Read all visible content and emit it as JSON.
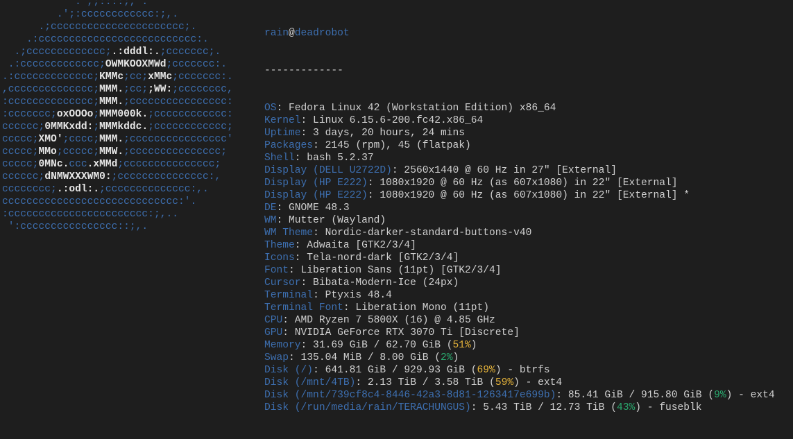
{
  "logo": [
    [
      [
        "b",
        "            .',;::::;,'."
      ]
    ],
    [
      [
        "b",
        "         .';:cccccccccccc:;,."
      ]
    ],
    [
      [
        "b",
        "      .;cccccccccccccccccccccc;."
      ]
    ],
    [
      [
        "b",
        "    .:cccccccccccccccccccccccccc:."
      ]
    ],
    [
      [
        "b",
        "  .;ccccccccccccc;"
      ],
      [
        "w",
        ".:dddl:."
      ],
      [
        "b",
        ";ccccccc;."
      ]
    ],
    [
      [
        "b",
        " .:ccccccccccccc;"
      ],
      [
        "w",
        "OWMKOOXMWd"
      ],
      [
        "b",
        ";ccccccc:."
      ]
    ],
    [
      [
        "b",
        ".:ccccccccccccc;"
      ],
      [
        "w",
        "KMMc"
      ],
      [
        "b",
        ";cc;"
      ],
      [
        "w",
        "xMMc"
      ],
      [
        "b",
        ";ccccccc:."
      ]
    ],
    [
      [
        "b",
        ",cccccccccccccc;"
      ],
      [
        "w",
        "MMM."
      ],
      [
        "b",
        ";cc;"
      ],
      [
        "w",
        ";WW:"
      ],
      [
        "b",
        ";cccccccc,"
      ]
    ],
    [
      [
        "b",
        ":cccccccccccccc;"
      ],
      [
        "w",
        "MMM."
      ],
      [
        "b",
        ";cccccccccccccccc:"
      ]
    ],
    [
      [
        "b",
        ":ccccccc;"
      ],
      [
        "w",
        "oxOOOo"
      ],
      [
        "b",
        ";"
      ],
      [
        "w",
        "MMM000k."
      ],
      [
        "b",
        ";cccccccccccc:"
      ]
    ],
    [
      [
        "b",
        "cccccc;"
      ],
      [
        "w",
        "0MMKxdd:"
      ],
      [
        "b",
        ";"
      ],
      [
        "w",
        "MMMkddc."
      ],
      [
        "b",
        ";cccccccccccc;"
      ]
    ],
    [
      [
        "b",
        "ccccc;"
      ],
      [
        "w",
        "XMO'"
      ],
      [
        "b",
        ";cccc;"
      ],
      [
        "w",
        "MMM."
      ],
      [
        "b",
        ";cccccccccccccccc'"
      ]
    ],
    [
      [
        "b",
        "ccccc;"
      ],
      [
        "w",
        "MMo"
      ],
      [
        "b",
        ";ccccc;"
      ],
      [
        "w",
        "MMW."
      ],
      [
        "b",
        ";ccccccccccccccc;"
      ]
    ],
    [
      [
        "b",
        "ccccc;"
      ],
      [
        "w",
        "0MNc."
      ],
      [
        "b",
        "ccc"
      ],
      [
        "w",
        ".xMMd"
      ],
      [
        "b",
        ";ccccccccccccccc;"
      ]
    ],
    [
      [
        "b",
        "cccccc;"
      ],
      [
        "w",
        "dNMWXXXWM0:"
      ],
      [
        "b",
        ";ccccccccccccccc:,"
      ]
    ],
    [
      [
        "b",
        "cccccccc;"
      ],
      [
        "w",
        ".:odl:."
      ],
      [
        "b",
        ";cccccccccccccc:,."
      ]
    ],
    [
      [
        "b",
        "ccccccccccccccccccccccccccccc:'."
      ]
    ],
    [
      [
        "b",
        ":ccccccccccccccccccccccc:;,.."
      ]
    ],
    [
      [
        "b",
        " ':cccccccccccccccc::;,."
      ]
    ]
  ],
  "header": {
    "user": "rain",
    "at": "@",
    "host": "deadrobot",
    "separator": "-------------"
  },
  "rows": [
    [
      [
        "k",
        "OS"
      ],
      [
        "c",
        ": Fedora Linux 42 (Workstation Edition) x86_64"
      ]
    ],
    [
      [
        "k",
        "Kernel"
      ],
      [
        "c",
        ": Linux 6.15.6-200.fc42.x86_64"
      ]
    ],
    [
      [
        "k",
        "Uptime"
      ],
      [
        "c",
        ": 3 days, 20 hours, 24 mins"
      ]
    ],
    [
      [
        "k",
        "Packages"
      ],
      [
        "c",
        ": 2145 (rpm), 45 (flatpak)"
      ]
    ],
    [
      [
        "k",
        "Shell"
      ],
      [
        "c",
        ": bash 5.2.37"
      ]
    ],
    [
      [
        "k",
        "Display (DELL U2722D)"
      ],
      [
        "c",
        ": 2560x1440 @ 60 Hz in 27\" [External]"
      ]
    ],
    [
      [
        "k",
        "Display (HP E222)"
      ],
      [
        "c",
        ": 1080x1920 @ 60 Hz (as 607x1080) in 22\" [External]"
      ]
    ],
    [
      [
        "k",
        "Display (HP E222)"
      ],
      [
        "c",
        ": 1080x1920 @ 60 Hz (as 607x1080) in 22\" [External] *"
      ]
    ],
    [
      [
        "k",
        "DE"
      ],
      [
        "c",
        ": GNOME 48.3"
      ]
    ],
    [
      [
        "k",
        "WM"
      ],
      [
        "c",
        ": Mutter (Wayland)"
      ]
    ],
    [
      [
        "k",
        "WM Theme"
      ],
      [
        "c",
        ": Nordic-darker-standard-buttons-v40"
      ]
    ],
    [
      [
        "k",
        "Theme"
      ],
      [
        "c",
        ": Adwaita [GTK2/3/4]"
      ]
    ],
    [
      [
        "k",
        "Icons"
      ],
      [
        "c",
        ": Tela-nord-dark [GTK2/3/4]"
      ]
    ],
    [
      [
        "k",
        "Font"
      ],
      [
        "c",
        ": Liberation Sans (11pt) [GTK2/3/4]"
      ]
    ],
    [
      [
        "k",
        "Cursor"
      ],
      [
        "c",
        ": Bibata-Modern-Ice (24px)"
      ]
    ],
    [
      [
        "k",
        "Terminal"
      ],
      [
        "c",
        ": Ptyxis 48.4"
      ]
    ],
    [
      [
        "k",
        "Terminal Font"
      ],
      [
        "c",
        ": Liberation Mono (11pt)"
      ]
    ],
    [
      [
        "k",
        "CPU"
      ],
      [
        "c",
        ": AMD Ryzen 7 5800X (16) @ 4.85 GHz"
      ]
    ],
    [
      [
        "k",
        "GPU"
      ],
      [
        "c",
        ": NVIDIA GeForce RTX 3070 Ti [Discrete]"
      ]
    ],
    [
      [
        "k",
        "Memory"
      ],
      [
        "c",
        ": 31.69 GiB / 62.70 GiB ("
      ],
      [
        "y",
        "51%"
      ],
      [
        "c",
        ")"
      ]
    ],
    [
      [
        "k",
        "Swap"
      ],
      [
        "c",
        ": 135.04 MiB / 8.00 GiB ("
      ],
      [
        "g",
        "2%"
      ],
      [
        "c",
        ")"
      ]
    ],
    [
      [
        "k",
        "Disk (/)"
      ],
      [
        "c",
        ": 641.81 GiB / 929.93 GiB ("
      ],
      [
        "y",
        "69%"
      ],
      [
        "c",
        ") - btrfs"
      ]
    ],
    [
      [
        "k",
        "Disk (/mnt/4TB)"
      ],
      [
        "c",
        ": 2.13 TiB / 3.58 TiB ("
      ],
      [
        "y",
        "59%"
      ],
      [
        "c",
        ") - ext4"
      ]
    ],
    [
      [
        "k",
        "Disk (/mnt/739cf8c4-8446-42a3-8d81-1263417e699b)"
      ],
      [
        "c",
        ": 85.41 GiB / 915.80 GiB ("
      ],
      [
        "g",
        "9%"
      ],
      [
        "c",
        ") - ext4"
      ]
    ],
    [
      [
        "k",
        "Disk (/run/media/rain/TERACHUNGUS)"
      ],
      [
        "c",
        ": 5.43 TiB / 12.73 TiB ("
      ],
      [
        "g",
        "43%"
      ],
      [
        "c",
        ") - fuseblk"
      ]
    ]
  ],
  "colors": {
    "background": "#1e1e1e",
    "key_blue": "#3d6fb0",
    "text": "#d0d0d0",
    "logo_white": "#e6e6e6",
    "pct_yellow": "#e5b33a",
    "pct_green": "#2aa96e"
  }
}
